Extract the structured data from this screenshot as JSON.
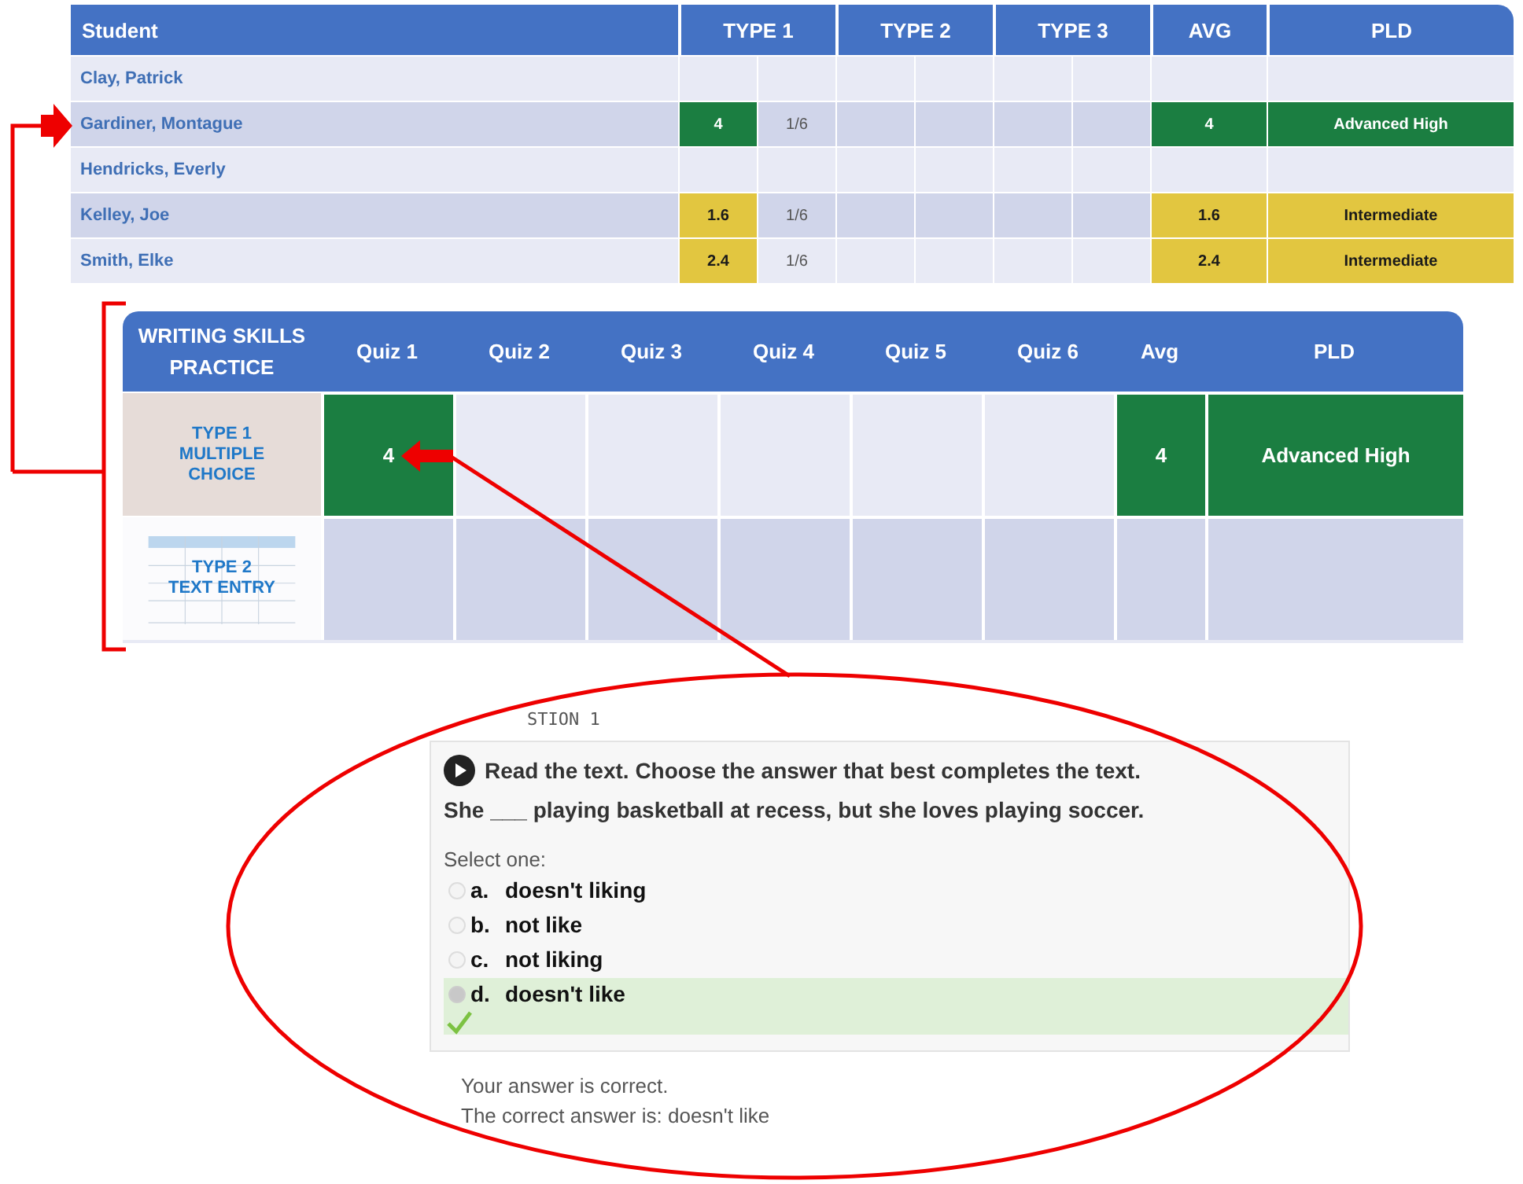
{
  "student_table": {
    "columns": [
      "Student",
      "TYPE 1",
      "TYPE 2",
      "TYPE 3",
      "AVG",
      "PLD"
    ],
    "rows": [
      {
        "student": "Clay, Patrick"
      },
      {
        "student": "Gardiner, Montague",
        "type1_score": "4",
        "type1_count": "1/6",
        "avg": "4",
        "pld": "Advanced High",
        "color": "#1b7e41"
      },
      {
        "student": "Hendricks, Everly"
      },
      {
        "student": "Kelley, Joe",
        "type1_score": "1.6",
        "type1_count": "1/6",
        "avg": "1.6",
        "pld": "Intermediate",
        "color": "#e2c640"
      },
      {
        "student": "Smith, Elke",
        "type1_score": "2.4",
        "type1_count": "1/6",
        "avg": "2.4",
        "pld": "Intermediate",
        "color": "#e2c640"
      }
    ]
  },
  "practice_table": {
    "title": "WRITING SKILLS\nPRACTICE",
    "columns": [
      "Quiz 1",
      "Quiz 2",
      "Quiz 3",
      "Quiz 4",
      "Quiz 5",
      "Quiz 6",
      "Avg",
      "PLD"
    ],
    "rows": [
      {
        "kind": "photo",
        "label": "TYPE 1\nMULTIPLE\nCHOICE",
        "scores": [
          "4"
        ],
        "avg": "4",
        "pld": "Advanced High",
        "color": "#1b7e41"
      },
      {
        "kind": "table",
        "label": "TYPE 2\nTEXT ENTRY"
      }
    ]
  },
  "quiz": {
    "heading": "STION 1",
    "instruction": "Read the text. Choose the answer that best completes the text.",
    "sentence": "She ___ playing basketball at recess, but she loves playing soccer.",
    "prompt": "Select one:",
    "options": [
      {
        "letter": "a.",
        "text": "doesn't liking",
        "selected": false,
        "correct": false
      },
      {
        "letter": "b.",
        "text": "not like",
        "selected": false,
        "correct": false
      },
      {
        "letter": "c.",
        "text": "not liking",
        "selected": false,
        "correct": false
      },
      {
        "letter": "d.",
        "text": "doesn't like",
        "selected": true,
        "correct": true
      }
    ],
    "feedback": [
      "Your answer is correct.",
      "The correct answer is: doesn't like"
    ]
  }
}
